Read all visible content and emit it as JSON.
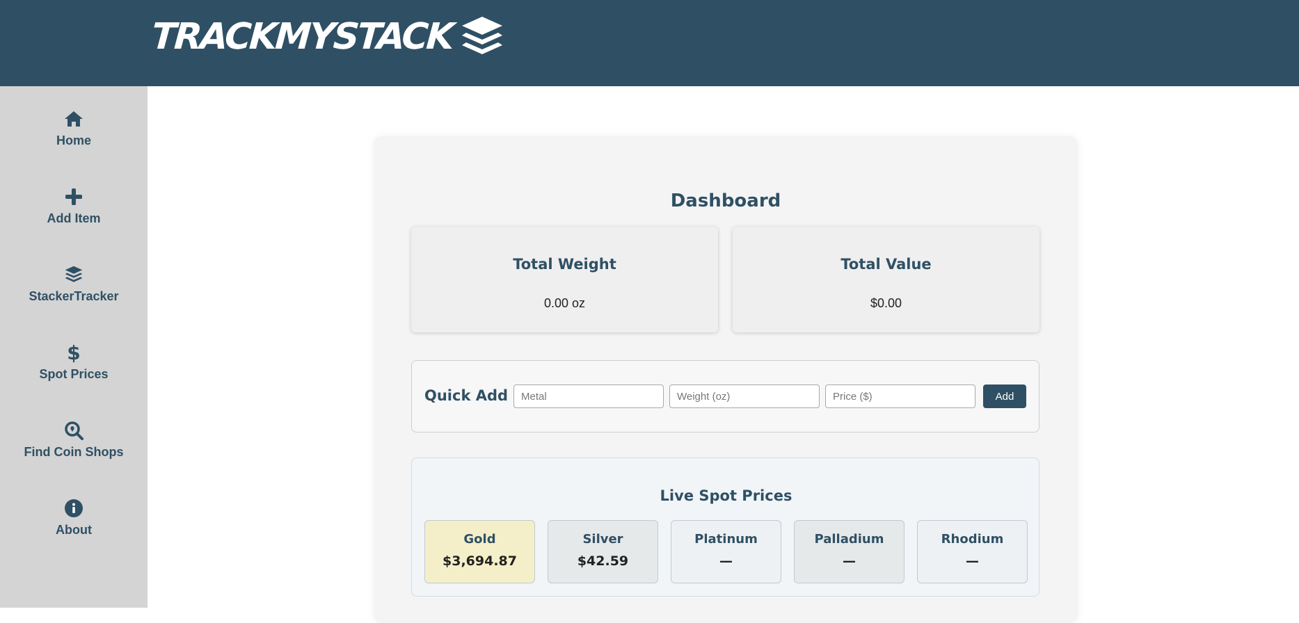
{
  "brand": {
    "name": "TRACKMYSTACK"
  },
  "sidebar": {
    "items": [
      {
        "label": "Home",
        "icon": "home-icon"
      },
      {
        "label": "Add Item",
        "icon": "plus-icon"
      },
      {
        "label": "StackerTracker",
        "icon": "layers-icon"
      },
      {
        "label": "Spot Prices",
        "icon": "dollar-icon"
      },
      {
        "label": "Find Coin Shops",
        "icon": "search-location-icon"
      },
      {
        "label": "About",
        "icon": "info-icon"
      }
    ]
  },
  "dashboard": {
    "title": "Dashboard",
    "total_weight": {
      "label": "Total Weight",
      "value": "0.00 oz"
    },
    "total_value": {
      "label": "Total Value",
      "value": "$0.00"
    }
  },
  "quick_add": {
    "label": "Quick Add",
    "metal_placeholder": "Metal",
    "weight_placeholder": "Weight (oz)",
    "price_placeholder": "Price ($)",
    "button_label": "Add"
  },
  "spot_prices": {
    "title": "Live Spot Prices",
    "metals": [
      {
        "name": "Gold",
        "price": "$3,694.87",
        "bg": "#f4efc9"
      },
      {
        "name": "Silver",
        "price": "$42.59",
        "bg": "#e6e9ea"
      },
      {
        "name": "Platinum",
        "price": "—",
        "bg": "#eef1f3"
      },
      {
        "name": "Palladium",
        "price": "—",
        "bg": "#e6e9ea"
      },
      {
        "name": "Rhodium",
        "price": "—",
        "bg": "#eef1f3"
      }
    ]
  },
  "colors": {
    "brand": "#2f5064",
    "sidebar": "#d4d4d4",
    "gold_highlight": "#f4efc9"
  }
}
